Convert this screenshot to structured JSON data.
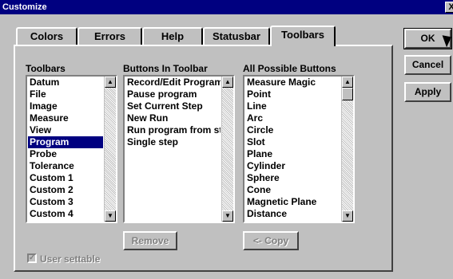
{
  "window": {
    "title": "Customize",
    "close_label": "X"
  },
  "tabs": [
    {
      "label": "Colors"
    },
    {
      "label": "Errors"
    },
    {
      "label": "Help"
    },
    {
      "label": "Statusbar"
    },
    {
      "label": "Toolbars",
      "active": true
    }
  ],
  "toolbars": {
    "label": "Toolbars",
    "items": [
      "Datum",
      "File",
      "Image",
      "Measure",
      "View",
      "Program",
      "Probe",
      "Tolerance",
      "Custom 1",
      "Custom 2",
      "Custom 3",
      "Custom 4"
    ],
    "selected": "Program"
  },
  "buttons_in_toolbar": {
    "label": "Buttons In Toolbar",
    "items": [
      "Record/Edit Program",
      "Pause program",
      "Set Current Step",
      "New Run",
      "Run program from st",
      "Single step"
    ]
  },
  "all_buttons": {
    "label": "All Possible Buttons",
    "items": [
      "Measure Magic",
      "Point",
      "Line",
      "Arc",
      "Circle",
      "Slot",
      "Plane",
      "Cylinder",
      "Sphere",
      "Cone",
      "Magnetic Plane",
      "Distance"
    ]
  },
  "actions": {
    "remove": "Remove",
    "copy": "<- Copy",
    "user_settable": "User settable",
    "ok": "OK",
    "cancel": "Cancel",
    "apply": "Apply"
  }
}
